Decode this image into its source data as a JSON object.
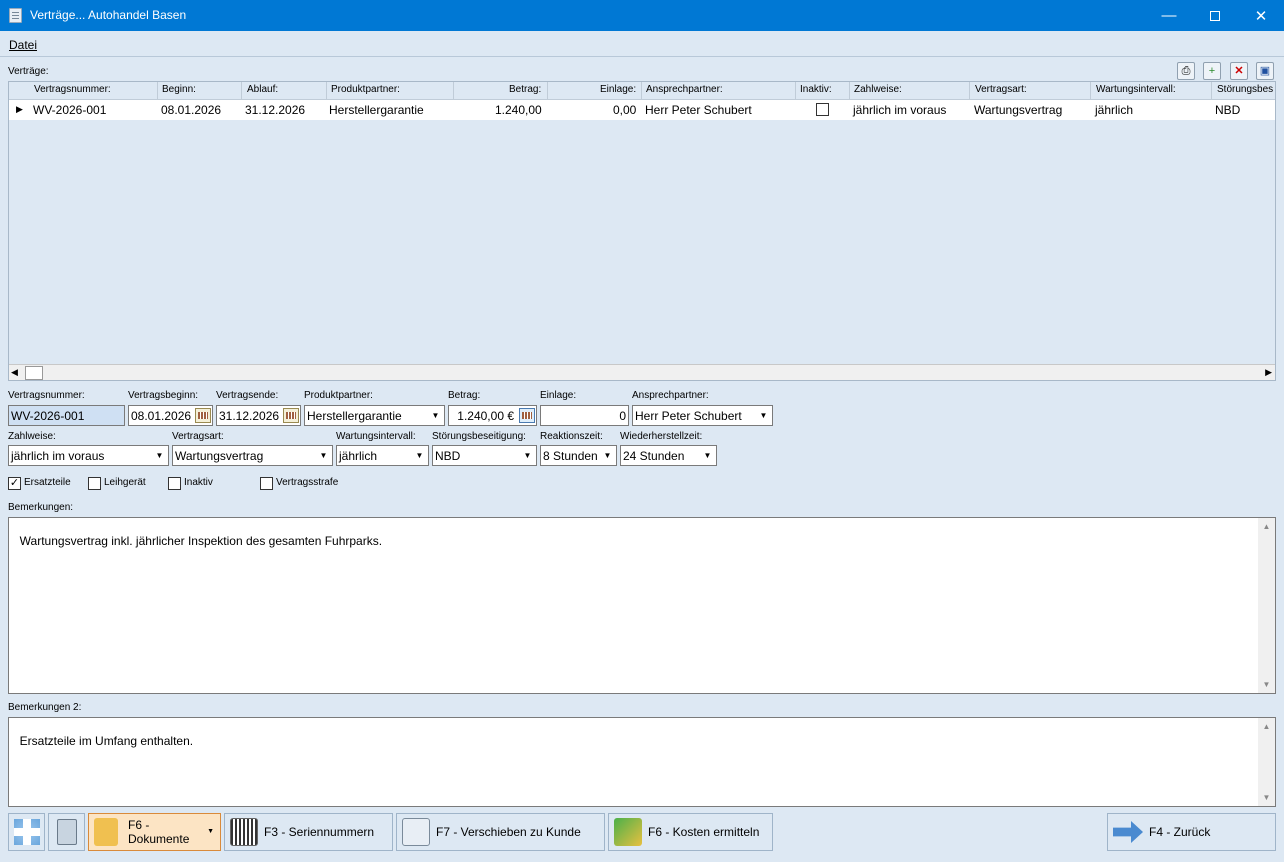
{
  "window": {
    "title": "Verträge... Autohandel Basen"
  },
  "menu": {
    "datei": "Datei"
  },
  "grid": {
    "label": "Verträge:",
    "columns": [
      "Vertragsnummer:",
      "Beginn:",
      "Ablauf:",
      "Produktpartner:",
      "Betrag:",
      "Einlage:",
      "Ansprechpartner:",
      "Inaktiv:",
      "Zahlweise:",
      "Vertragsart:",
      "Wartungsintervall:",
      "Störungsbes"
    ],
    "row": {
      "vertragsnummer": "WV-2026-001",
      "beginn": "08.01.2026",
      "ablauf": "31.12.2026",
      "produktpartner": "Herstellergarantie",
      "betrag": "1.240,00",
      "einlage": "0,00",
      "ansprechpartner": "Herr Peter Schubert",
      "inaktiv": false,
      "zahlweise": "jährlich im voraus",
      "vertragsart": "Wartungsvertrag",
      "wartungsintervall": "jährlich",
      "stoerung": "NBD"
    }
  },
  "form": {
    "labels": {
      "vertragsnummer": "Vertragsnummer:",
      "beginn": "Vertragsbeginn:",
      "ende": "Vertragsende:",
      "produktpartner": "Produktpartner:",
      "betrag": "Betrag:",
      "einlage": "Einlage:",
      "ansprechpartner": "Ansprechpartner:",
      "zahlweise": "Zahlweise:",
      "vertragsart": "Vertragsart:",
      "wartungsintervall": "Wartungsintervall:",
      "stoerung": "Störungsbeseitigung:",
      "reaktion": "Reaktionszeit:",
      "wiederherstell": "Wiederherstellzeit:",
      "bemerkungen": "Bemerkungen:",
      "bemerkungen2": "Bemerkungen 2:"
    },
    "values": {
      "vertragsnummer": "WV-2026-001",
      "beginn": "08.01.2026",
      "ende": "31.12.2026",
      "produktpartner": "Herstellergarantie",
      "betrag": "1.240,00 €",
      "einlage": "0",
      "ansprechpartner": "Herr Peter Schubert",
      "zahlweise": "jährlich im voraus",
      "vertragsart": "Wartungsvertrag",
      "wartungsintervall": "jährlich",
      "stoerung": "NBD",
      "reaktion": "8 Stunden",
      "wiederherstell": "24 Stunden"
    },
    "checkboxes": {
      "ersatzteile": "Ersatzteile",
      "leihgeraet": "Leihgerät",
      "inaktiv": "Inaktiv",
      "vertragsstrafe": "Vertragsstrafe"
    },
    "checked": {
      "ersatzteile": true,
      "leihgeraet": false,
      "inaktiv": false,
      "vertragsstrafe": false
    },
    "bemerkungen": "Wartungsvertrag inkl. jährlicher Inspektion des gesamten Fuhrparks.",
    "bemerkungen2": "Ersatzteile im Umfang enthalten."
  },
  "buttons": {
    "dokumente": "F6 -\nDokumente",
    "seriennummern": "F3 - Seriennummern",
    "verschieben": "F7 - Verschieben zu Kunde",
    "kosten": "F6 - Kosten ermitteln",
    "zurueck": "F4 - Zurück"
  }
}
